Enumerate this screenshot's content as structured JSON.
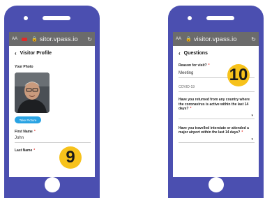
{
  "left": {
    "url": "sitor.vpass.io",
    "aa_label": "AA",
    "title": "Visitor Profile",
    "photo_label": "Your Photo",
    "take_picture_label": "Take Picture",
    "first_name_label": "First Name",
    "first_name_value": "John",
    "last_name_label": "Last Name",
    "required_mark": "*",
    "step_badge": "9"
  },
  "right": {
    "url": "visitor.vpass.io",
    "aa_label": "AA",
    "title": "Questions",
    "reason_label": "Reason for visit?",
    "reason_value": "Meeting",
    "section_label": "COVID-19",
    "q1": "Have you returned from any country where the coronavirus is active within the last 14 days?",
    "q2": "Have you travelled interstate or attended a major airport within the last 14 days?",
    "required_mark": "*",
    "step_badge": "10"
  },
  "colors": {
    "phone": "#4b4fb0",
    "badge": "#f7c21b",
    "button": "#29a3e3",
    "required": "#e53935"
  }
}
